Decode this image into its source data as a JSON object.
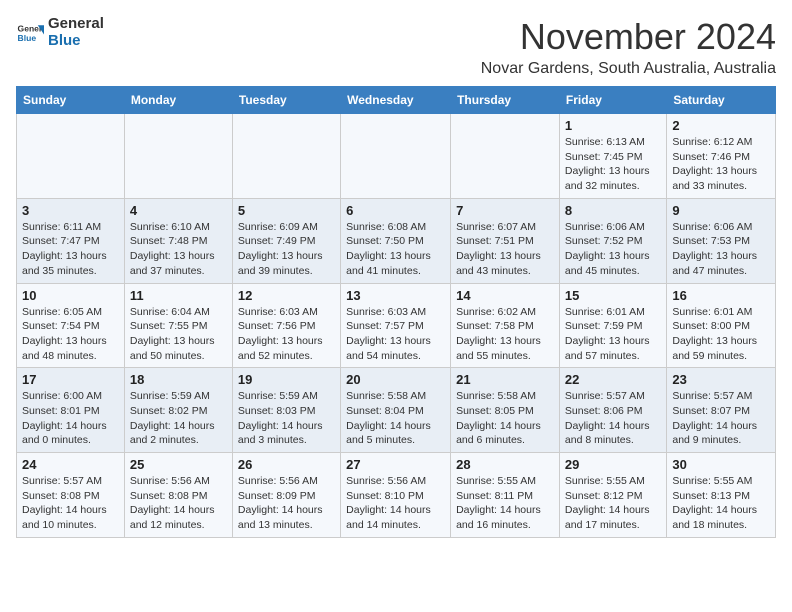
{
  "header": {
    "logo_general": "General",
    "logo_blue": "Blue",
    "month_title": "November 2024",
    "subtitle": "Novar Gardens, South Australia, Australia"
  },
  "weekdays": [
    "Sunday",
    "Monday",
    "Tuesday",
    "Wednesday",
    "Thursday",
    "Friday",
    "Saturday"
  ],
  "weeks": [
    [
      {
        "day": "",
        "info": ""
      },
      {
        "day": "",
        "info": ""
      },
      {
        "day": "",
        "info": ""
      },
      {
        "day": "",
        "info": ""
      },
      {
        "day": "",
        "info": ""
      },
      {
        "day": "1",
        "info": "Sunrise: 6:13 AM\nSunset: 7:45 PM\nDaylight: 13 hours and 32 minutes."
      },
      {
        "day": "2",
        "info": "Sunrise: 6:12 AM\nSunset: 7:46 PM\nDaylight: 13 hours and 33 minutes."
      }
    ],
    [
      {
        "day": "3",
        "info": "Sunrise: 6:11 AM\nSunset: 7:47 PM\nDaylight: 13 hours and 35 minutes."
      },
      {
        "day": "4",
        "info": "Sunrise: 6:10 AM\nSunset: 7:48 PM\nDaylight: 13 hours and 37 minutes."
      },
      {
        "day": "5",
        "info": "Sunrise: 6:09 AM\nSunset: 7:49 PM\nDaylight: 13 hours and 39 minutes."
      },
      {
        "day": "6",
        "info": "Sunrise: 6:08 AM\nSunset: 7:50 PM\nDaylight: 13 hours and 41 minutes."
      },
      {
        "day": "7",
        "info": "Sunrise: 6:07 AM\nSunset: 7:51 PM\nDaylight: 13 hours and 43 minutes."
      },
      {
        "day": "8",
        "info": "Sunrise: 6:06 AM\nSunset: 7:52 PM\nDaylight: 13 hours and 45 minutes."
      },
      {
        "day": "9",
        "info": "Sunrise: 6:06 AM\nSunset: 7:53 PM\nDaylight: 13 hours and 47 minutes."
      }
    ],
    [
      {
        "day": "10",
        "info": "Sunrise: 6:05 AM\nSunset: 7:54 PM\nDaylight: 13 hours and 48 minutes."
      },
      {
        "day": "11",
        "info": "Sunrise: 6:04 AM\nSunset: 7:55 PM\nDaylight: 13 hours and 50 minutes."
      },
      {
        "day": "12",
        "info": "Sunrise: 6:03 AM\nSunset: 7:56 PM\nDaylight: 13 hours and 52 minutes."
      },
      {
        "day": "13",
        "info": "Sunrise: 6:03 AM\nSunset: 7:57 PM\nDaylight: 13 hours and 54 minutes."
      },
      {
        "day": "14",
        "info": "Sunrise: 6:02 AM\nSunset: 7:58 PM\nDaylight: 13 hours and 55 minutes."
      },
      {
        "day": "15",
        "info": "Sunrise: 6:01 AM\nSunset: 7:59 PM\nDaylight: 13 hours and 57 minutes."
      },
      {
        "day": "16",
        "info": "Sunrise: 6:01 AM\nSunset: 8:00 PM\nDaylight: 13 hours and 59 minutes."
      }
    ],
    [
      {
        "day": "17",
        "info": "Sunrise: 6:00 AM\nSunset: 8:01 PM\nDaylight: 14 hours and 0 minutes."
      },
      {
        "day": "18",
        "info": "Sunrise: 5:59 AM\nSunset: 8:02 PM\nDaylight: 14 hours and 2 minutes."
      },
      {
        "day": "19",
        "info": "Sunrise: 5:59 AM\nSunset: 8:03 PM\nDaylight: 14 hours and 3 minutes."
      },
      {
        "day": "20",
        "info": "Sunrise: 5:58 AM\nSunset: 8:04 PM\nDaylight: 14 hours and 5 minutes."
      },
      {
        "day": "21",
        "info": "Sunrise: 5:58 AM\nSunset: 8:05 PM\nDaylight: 14 hours and 6 minutes."
      },
      {
        "day": "22",
        "info": "Sunrise: 5:57 AM\nSunset: 8:06 PM\nDaylight: 14 hours and 8 minutes."
      },
      {
        "day": "23",
        "info": "Sunrise: 5:57 AM\nSunset: 8:07 PM\nDaylight: 14 hours and 9 minutes."
      }
    ],
    [
      {
        "day": "24",
        "info": "Sunrise: 5:57 AM\nSunset: 8:08 PM\nDaylight: 14 hours and 10 minutes."
      },
      {
        "day": "25",
        "info": "Sunrise: 5:56 AM\nSunset: 8:08 PM\nDaylight: 14 hours and 12 minutes."
      },
      {
        "day": "26",
        "info": "Sunrise: 5:56 AM\nSunset: 8:09 PM\nDaylight: 14 hours and 13 minutes."
      },
      {
        "day": "27",
        "info": "Sunrise: 5:56 AM\nSunset: 8:10 PM\nDaylight: 14 hours and 14 minutes."
      },
      {
        "day": "28",
        "info": "Sunrise: 5:55 AM\nSunset: 8:11 PM\nDaylight: 14 hours and 16 minutes."
      },
      {
        "day": "29",
        "info": "Sunrise: 5:55 AM\nSunset: 8:12 PM\nDaylight: 14 hours and 17 minutes."
      },
      {
        "day": "30",
        "info": "Sunrise: 5:55 AM\nSunset: 8:13 PM\nDaylight: 14 hours and 18 minutes."
      }
    ]
  ]
}
